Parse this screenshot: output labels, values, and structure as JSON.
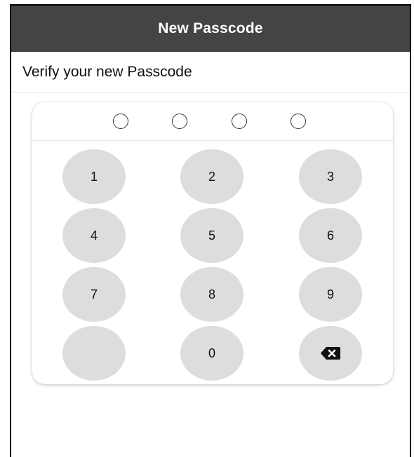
{
  "header": {
    "title": "New Passcode"
  },
  "instruction": {
    "text": "Verify your new Passcode"
  },
  "passcode": {
    "length": 4,
    "entered": 0
  },
  "keypad": {
    "keys": [
      "1",
      "2",
      "3",
      "4",
      "5",
      "6",
      "7",
      "8",
      "9",
      "",
      "0",
      "backspace-icon"
    ]
  },
  "colors": {
    "nav_bar": "#444444",
    "key_background": "#dddddd"
  }
}
